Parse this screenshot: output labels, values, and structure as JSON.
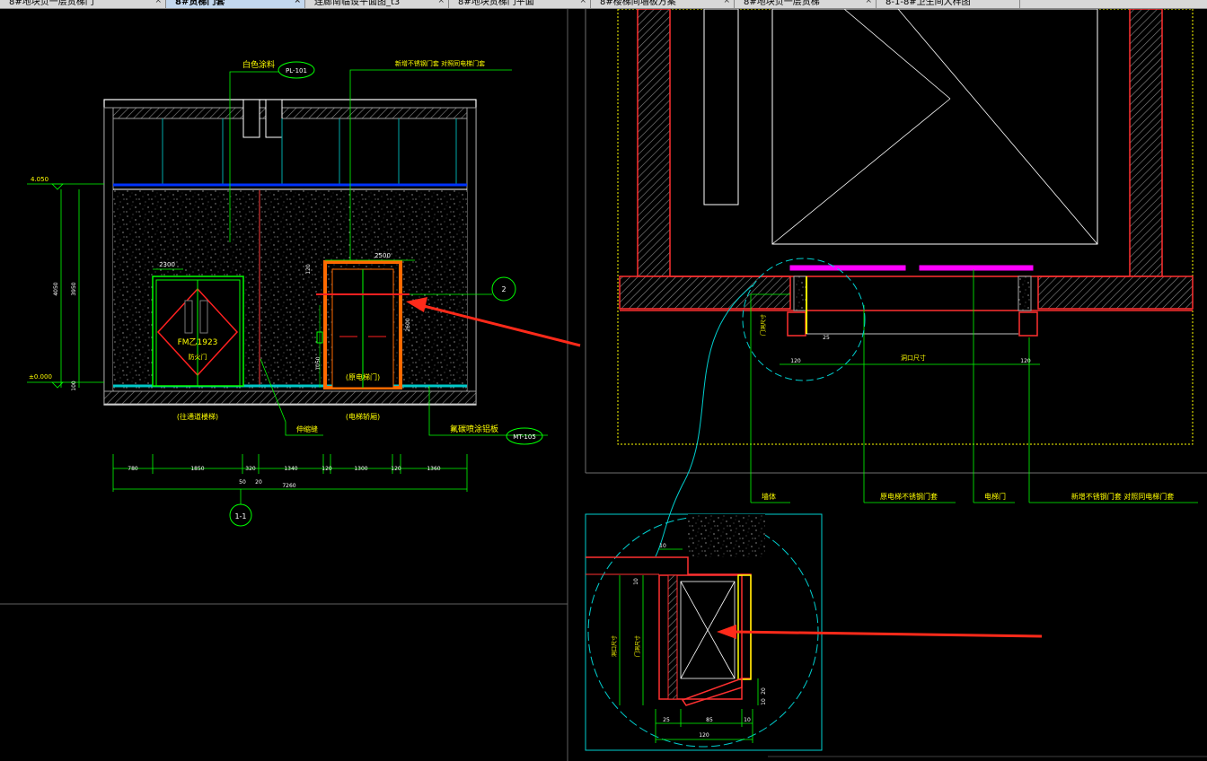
{
  "tabs": [
    {
      "label": "8#地块负一层货梯门",
      "close": "×"
    },
    {
      "label": "8#货梯门套",
      "close": "×"
    },
    {
      "label": "连廊南临设平面图_t3",
      "close": "×"
    },
    {
      "label": "8#地块货梯门平面",
      "close": "×"
    },
    {
      "label": "8#楼梯间墙板方案",
      "close": "×"
    },
    {
      "label": "8#地块负一层货梯",
      "close": "×"
    },
    {
      "label": "8-1-8#卫生间大样图",
      "close": ""
    }
  ],
  "elevation": {
    "white_paint": "白色涂料",
    "pl_tag": "PL-101",
    "steel_door_frame": "新增不锈钢门套 对照同电梯门套",
    "level_top": "4.050",
    "level_zero": "±0.000",
    "dim_4050": "4050",
    "dim_3950": "3950",
    "dim_100": "100",
    "door_width_left": "2300",
    "door_width_right": "2500",
    "fire_door_code": "FM乙1923",
    "fire_door_name": "防火门",
    "dim_120_top": "120",
    "dim_2600": "2600",
    "dim_1050": "1050",
    "elevator_door": "(原电梯门)",
    "callout_2": "2",
    "corridor_label": "(往通道楼梯)",
    "elevator_label": "(电梯轿厢)",
    "expansion_joint": "伸缩缝",
    "aluminum_panel": "氟碳喷涂铝板",
    "mt_tag": "MT-105",
    "section_mark": "1-1",
    "dims_bottom": [
      "780",
      "1850",
      "320",
      "1340",
      "120",
      "1300",
      "120",
      "1360"
    ],
    "dims_bottom2": [
      "50",
      "20"
    ],
    "dim_total": "7260"
  },
  "plan": {
    "wall_label": "墙体",
    "frame_label": "原电梯不锈钢门套",
    "elevator_door": "电梯门",
    "new_frame": "新增不锈钢门套 对照同电梯门套",
    "dim_120_left": "120",
    "dim_opening": "洞口尺寸",
    "dim_120_right": "120",
    "dim_small": "门洞尺寸",
    "dim_25": "25"
  },
  "detail": {
    "dim_10_top": "10",
    "dim_10_side": "10",
    "dim_vertical": "洞口尺寸",
    "dim_vertical2": "门洞尺寸",
    "dims_bottom": [
      "25",
      "85",
      "10"
    ],
    "dim_120": "120",
    "dim_20": "20",
    "dim_10": "10"
  },
  "colors": {
    "background": "#000000",
    "green": "#00ff00",
    "yellow": "#ffff00",
    "red": "#ff0000",
    "cyan": "#00ffff",
    "orange": "#ff6a00",
    "magenta": "#ff00ff",
    "white": "#ffffff",
    "arrow": "#ff2a1a"
  }
}
